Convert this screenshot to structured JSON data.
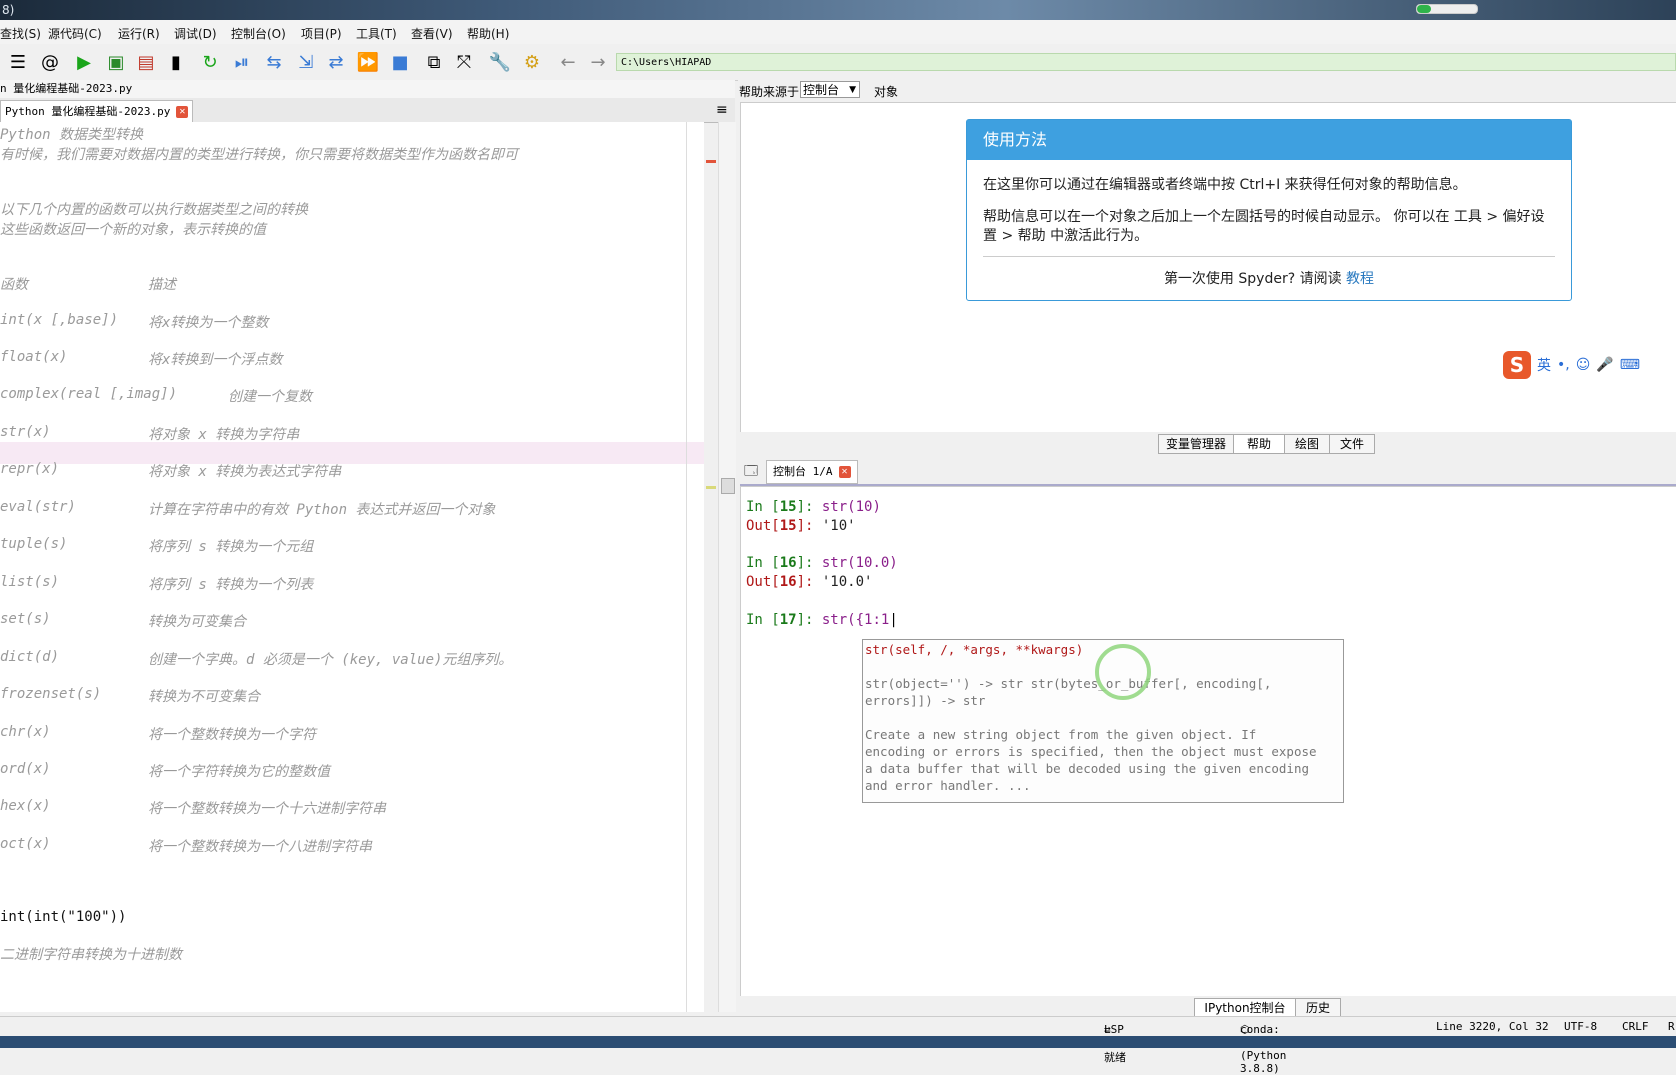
{
  "window": {
    "title_fragment": "8)"
  },
  "menu": [
    "查找(S)",
    "源代码(C)",
    "运行(R)",
    "调试(D)",
    "控制台(O)",
    "项目(P)",
    "工具(T)",
    "查看(V)",
    "帮助(H)"
  ],
  "toolbar": {
    "icons": [
      "list-icon",
      "at-icon",
      "run-icon",
      "run-cell-icon",
      "run-cell-advance-icon",
      "run-selection-icon",
      "rerun-icon",
      "debug-icon",
      "step-icon",
      "step-into-icon",
      "step-return-icon",
      "continue-icon",
      "stop-icon",
      "maximize-pane-icon",
      "fullscreen-icon",
      "preferences-icon",
      "python-path-icon",
      "back-icon",
      "forward-icon"
    ],
    "path": "C:\\Users\\HIAPAD"
  },
  "editor": {
    "path_label": "n 量化编程基础-2023.py",
    "tab_label": "Python 量化编程基础-2023.py",
    "lines": [
      {
        "c1": "Python 数据类型转换",
        "c2": ""
      },
      {
        "c1": "有时候，我们需要对数据内置的类型进行转换，你只需要将数据类型作为函数名即可",
        "c2": ""
      },
      {
        "c1": "以下几个内置的函数可以执行数据类型之间的转换",
        "c2": ""
      },
      {
        "c1": "这些函数返回一个新的对象，表示转换的值",
        "c2": ""
      },
      {
        "c1": "函数",
        "c2": "描述"
      },
      {
        "c1": "int(x [,base])",
        "c2": "将x转换为一个整数"
      },
      {
        "c1": "float(x)",
        "c2": "将x转换到一个浮点数"
      },
      {
        "c1": "complex(real [,imag])",
        "c2": "创建一个复数"
      },
      {
        "c1": "str(x)",
        "c2": "将对象 x 转换为字符串"
      },
      {
        "c1": "repr(x)",
        "c2": "将对象 x 转换为表达式字符串"
      },
      {
        "c1": "eval(str)",
        "c2": "计算在字符串中的有效 Python 表达式并返回一个对象"
      },
      {
        "c1": "tuple(s)",
        "c2": "将序列 s 转换为一个元组"
      },
      {
        "c1": "list(s)",
        "c2": "将序列 s 转换为一个列表"
      },
      {
        "c1": "set(s)",
        "c2": "转换为可变集合"
      },
      {
        "c1": "dict(d)",
        "c2": "创建一个字典。d 必须是一个 (key, value)元组序列。"
      },
      {
        "c1": "frozenset(s)",
        "c2": "转换为不可变集合"
      },
      {
        "c1": "chr(x)",
        "c2": "将一个整数转换为一个字符"
      },
      {
        "c1": "ord(x)",
        "c2": "将一个字符转换为它的整数值"
      },
      {
        "c1": "hex(x)",
        "c2": "将一个整数转换为一个十六进制字符串"
      },
      {
        "c1": "oct(x)",
        "c2": "将一个整数转换为一个八进制字符串"
      }
    ],
    "code_line": "int(int(\"100\"))",
    "last_comment": "二进制字符串转换为十进制数"
  },
  "help": {
    "source_label": "帮助来源于",
    "source_value": "控制台",
    "object_label": "对象",
    "card_title": "使用方法",
    "para1": "在这里你可以通过在编辑器或者终端中按 Ctrl+I 来获得任何对象的帮助信息。",
    "para2": "帮助信息可以在一个对象之后加上一个左圆括号的时候自动显示。 你可以在 工具 > 偏好设置 > 帮助 中激活此行为。",
    "footer_text": "第一次使用 Spyder? 请阅读",
    "footer_link": "教程",
    "ime": {
      "logo": "S",
      "lang": "英"
    }
  },
  "pane_tabs": [
    "变量管理器",
    "帮助",
    "绘图",
    "文件"
  ],
  "console": {
    "tab_label": "控制台 1/A",
    "entries": [
      {
        "in_num": "15",
        "input": "str(10)",
        "out_num": "15",
        "output": "'10'"
      },
      {
        "in_num": "16",
        "input": "str(10.0)",
        "out_num": "16",
        "output": "'10.0'"
      }
    ],
    "current": {
      "in_num": "17",
      "input": "str({1:1"
    },
    "calltip": {
      "signature": "str(self, /, *args, **kwargs)",
      "line2": "str(object='') -> str str(bytes_or_buffer[, encoding[,",
      "line3": "errors]]) -> str",
      "doc1": "Create a new string object from the given object. If",
      "doc2": "encoding or errors is specified, then the object must expose",
      "doc3": "a data buffer that will be decoded using the given encoding",
      "doc4": "and error handler. ..."
    },
    "bottom_tabs": [
      "IPython控制台",
      "历史"
    ]
  },
  "status": {
    "lsp": "LSP Python: 就绪",
    "conda": "conda: base (Python 3.8.8)",
    "position": "Line 3220, Col 32",
    "encoding": "UTF-8",
    "eol": "CRLF",
    "extra": "R"
  }
}
